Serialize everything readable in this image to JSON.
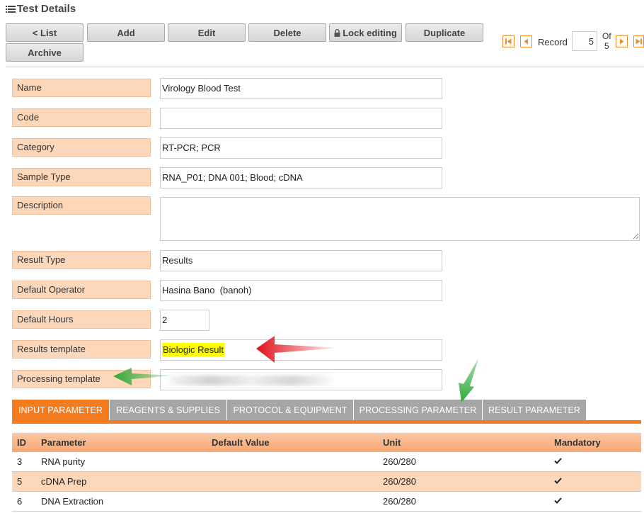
{
  "header": {
    "title": "Test Details",
    "title_icon": "list-icon"
  },
  "toolbar": {
    "list": "< List",
    "add": "Add",
    "edit": "Edit",
    "delete": "Delete",
    "lock_editing": "Lock editing",
    "duplicate": "Duplicate",
    "archive": "Archive"
  },
  "pager": {
    "record_label": "Record",
    "current": "5",
    "of_label": "Of",
    "total": "5"
  },
  "form": {
    "name": {
      "label": "Name",
      "value": "Virology Blood Test"
    },
    "code": {
      "label": "Code",
      "value": ""
    },
    "category": {
      "label": "Category",
      "value": "RT-PCR; PCR"
    },
    "sample_type": {
      "label": "Sample Type",
      "value": "RNA_P01; DNA 001; Blood; cDNA"
    },
    "description": {
      "label": "Description",
      "value": ""
    },
    "result_type": {
      "label": "Result Type",
      "value": "Results"
    },
    "default_operator": {
      "label": "Default Operator",
      "value": "Hasina Bano  (banoh)"
    },
    "default_hours": {
      "label": "Default Hours",
      "value": "2"
    },
    "results_template": {
      "label": "Results template",
      "value": "Biologic Result"
    },
    "processing_template": {
      "label": "Processing template",
      "value": ""
    }
  },
  "tabs": [
    {
      "label": "INPUT PARAMETER",
      "active": true
    },
    {
      "label": "REAGENTS & SUPPLIES",
      "active": false
    },
    {
      "label": "PROTOCOL & EQUIPMENT",
      "active": false
    },
    {
      "label": "PROCESSING PARAMETER",
      "active": false
    },
    {
      "label": "RESULT PARAMETER",
      "active": false
    }
  ],
  "table": {
    "columns": [
      "ID",
      "Parameter",
      "Default Value",
      "Unit",
      "Mandatory"
    ],
    "rows": [
      {
        "id": "3",
        "parameter": "RNA purity",
        "default_value": "",
        "unit": "260/280",
        "mandatory": true
      },
      {
        "id": "5",
        "parameter": "cDNA Prep",
        "default_value": "",
        "unit": "260/280",
        "mandatory": true
      },
      {
        "id": "6",
        "parameter": "DNA Extraction",
        "default_value": "",
        "unit": "260/280",
        "mandatory": true
      }
    ]
  },
  "colors": {
    "accent": "#f47c1f",
    "label_bg": "#fdd7b9",
    "highlight": "#ffff00",
    "tab_inactive": "#a6a6a6",
    "annotation_red": "#e31b1b",
    "annotation_green": "#2eaa3a"
  }
}
